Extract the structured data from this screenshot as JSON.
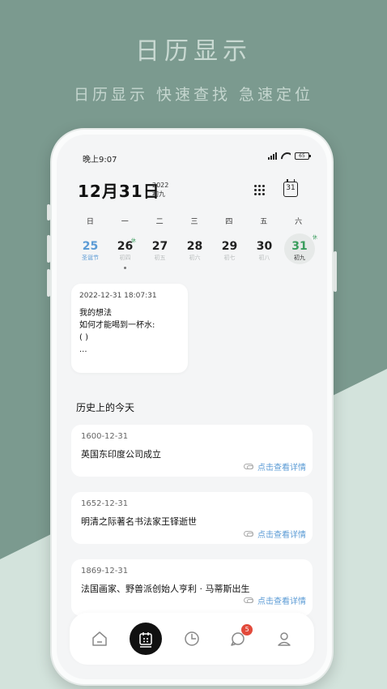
{
  "promo": {
    "title": "日历显示",
    "subtitle": "日历显示 快速查找 急速定位"
  },
  "status": {
    "time": "晚上9:07",
    "battery": "65"
  },
  "header": {
    "date": "12月31日",
    "year": "2022",
    "lunar": "初九",
    "calendar_icon_day": "31"
  },
  "weekdays": [
    "日",
    "一",
    "二",
    "三",
    "四",
    "五",
    "六"
  ],
  "days": [
    {
      "num": "25",
      "lunar": "圣诞节"
    },
    {
      "num": "26",
      "lunar": "初四",
      "mark": "休"
    },
    {
      "num": "27",
      "lunar": "初五"
    },
    {
      "num": "28",
      "lunar": "初六"
    },
    {
      "num": "29",
      "lunar": "初七"
    },
    {
      "num": "30",
      "lunar": "初八"
    },
    {
      "num": "31",
      "lunar": "初九",
      "mark": "休"
    }
  ],
  "note": {
    "timestamp": "2022-12-31  18:07:31",
    "lines": [
      "我的想法",
      "如何才能喝到一杯水:",
      "( )",
      "..."
    ]
  },
  "history": {
    "title": "历史上的今天",
    "link_label": "点击查看详情",
    "events": [
      {
        "date": "1600-12-31",
        "text": "英国东印度公司成立"
      },
      {
        "date": "1652-12-31",
        "text": "明清之际著名书法家王铎逝世"
      },
      {
        "date": "1869-12-31",
        "text": "法国画家、野兽派创始人亨利 · 马蒂斯出生"
      }
    ]
  },
  "tabbar": {
    "notification_count": "5"
  },
  "colors": {
    "accent_green": "#3a9d5d",
    "link_blue": "#5b9bd5",
    "bg_green": "#7b9a8f"
  }
}
